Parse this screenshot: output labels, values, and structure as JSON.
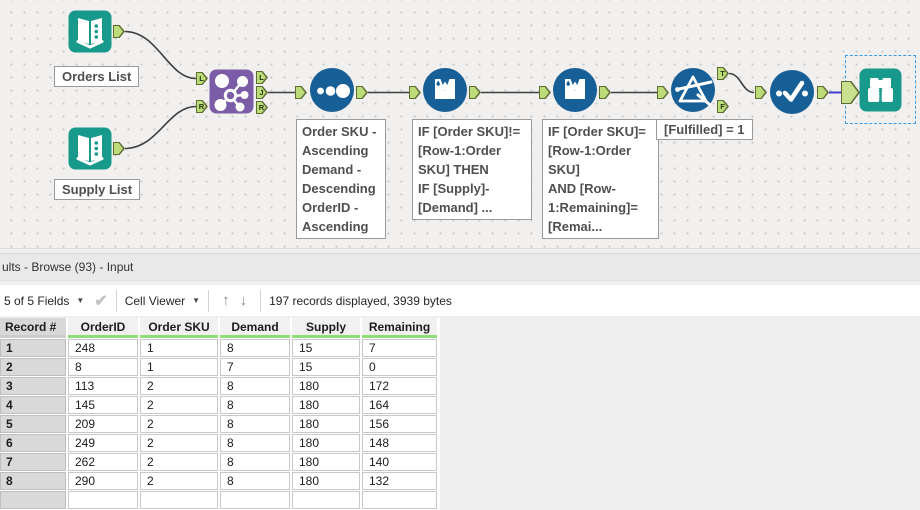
{
  "colors": {
    "tool_teal": "#17998b",
    "tool_blue": "#175f97",
    "join_purple": "#7b5ca7",
    "anchor_green": "#bcdb79",
    "wire": "#3f3f3f",
    "selected_wire": "#3f3fd3",
    "selection_dash_blue": "#3c9ce8",
    "header_quality_green": "#8ede78"
  },
  "canvas": {
    "labels": {
      "orders": "Orders List",
      "supply": "Supply List"
    },
    "annotations": {
      "sort": "Order SKU -\nAscending\nDemand -\nDescending\nOrderID -\nAscending",
      "formula1": "IF [Order SKU]!=\n[Row-1:Order\nSKU] THEN\nIF [Supply]-\n[Demand] ...",
      "formula2": "IF [Order SKU]=\n[Row-1:Order\nSKU]\nAND [Row-\n1:Remaining]=\n[Remai...",
      "filter": "[Fulfilled] = 1"
    },
    "anchors": {
      "join_left": [
        "L",
        "R"
      ],
      "join_right": [
        "L",
        "J",
        "R"
      ],
      "filter_right": [
        "T",
        "F"
      ]
    }
  },
  "results": {
    "title": "ults - Browse (93) - Input",
    "toolbar": {
      "fields": "5 of 5 Fields",
      "viewer": "Cell Viewer",
      "records": "197 records displayed, 3939 bytes"
    },
    "table": {
      "columns": [
        "Record #",
        "OrderID",
        "Order SKU",
        "Demand",
        "Supply",
        "Remaining"
      ],
      "rows": [
        [
          "1",
          "248",
          "1",
          "8",
          "15",
          "7"
        ],
        [
          "2",
          "8",
          "1",
          "7",
          "15",
          "0"
        ],
        [
          "3",
          "113",
          "2",
          "8",
          "180",
          "172"
        ],
        [
          "4",
          "145",
          "2",
          "8",
          "180",
          "164"
        ],
        [
          "5",
          "209",
          "2",
          "8",
          "180",
          "156"
        ],
        [
          "6",
          "249",
          "2",
          "8",
          "180",
          "148"
        ],
        [
          "7",
          "262",
          "2",
          "8",
          "180",
          "140"
        ],
        [
          "8",
          "290",
          "2",
          "8",
          "180",
          "132"
        ]
      ]
    }
  }
}
